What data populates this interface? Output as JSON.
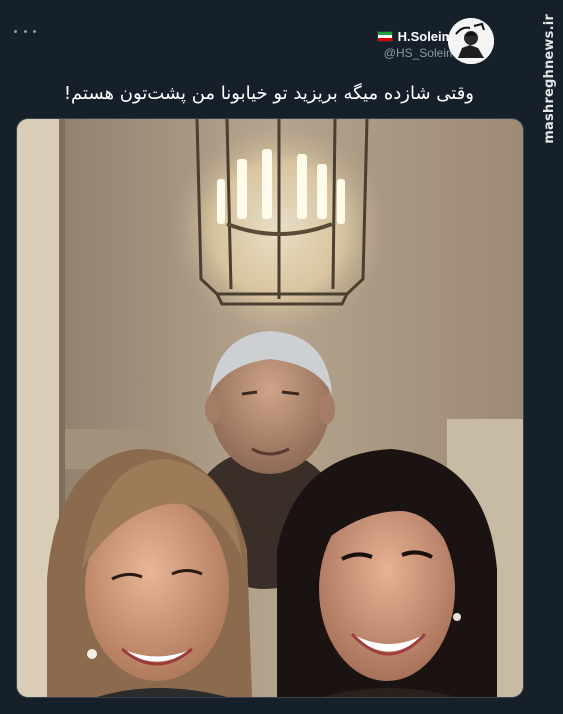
{
  "tweet": {
    "author": {
      "display_name": "H.Soleimani",
      "handle": "@HS_Soleimani",
      "flag_icon": "iran-flag-icon",
      "avatar_icon": "avatar-icon"
    },
    "more_icon": "more-options-icon",
    "text": "وقتی شازده میگه بریزید تو خیابونا من پشت‌تون هستم!",
    "media": {
      "kind": "photo",
      "description_icon": "photo-icon"
    }
  },
  "watermark": {
    "text": "mashreghnews.ir"
  },
  "colors": {
    "background": "#15202b",
    "primary_text": "#ffffff",
    "secondary_text": "#8899a6",
    "border": "#38444d"
  }
}
